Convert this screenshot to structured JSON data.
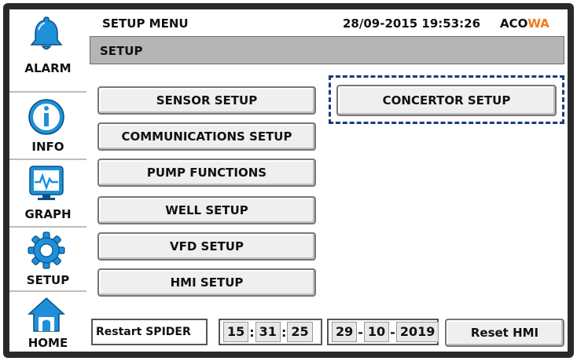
{
  "header": {
    "title": "SETUP MENU",
    "datetime": "28/09-2015  19:53:26",
    "brand_prefix": "ACO",
    "brand_suffix": "WA"
  },
  "section": {
    "title": "SETUP"
  },
  "sidebar": {
    "items": [
      {
        "label": "ALARM",
        "icon": "bell-icon"
      },
      {
        "label": "INFO",
        "icon": "info-icon"
      },
      {
        "label": "GRAPH",
        "icon": "monitor-graph-icon"
      },
      {
        "label": "SETUP",
        "icon": "gear-icon"
      },
      {
        "label": "HOME",
        "icon": "house-icon"
      }
    ]
  },
  "menu": {
    "buttons": [
      "SENSOR SETUP",
      "COMMUNICATIONS SETUP",
      "PUMP FUNCTIONS",
      "WELL SETUP",
      "VFD SETUP",
      "HMI SETUP"
    ],
    "concentrator": "CONCERTOR SETUP"
  },
  "footer": {
    "restart_label": "Restart SPIDER",
    "time": {
      "hour": "15",
      "minute": "31",
      "second": "25"
    },
    "date": {
      "day": "29",
      "month": "10",
      "year": "2019"
    },
    "time_sep": ":",
    "date_sep": "-",
    "reset_label": "Reset HMI"
  },
  "colors": {
    "bezel": "#2a2a2a",
    "section_bar": "#b5b5b5",
    "brand_accent": "#f07a1a",
    "selection_outline": "#1b3a7a",
    "icon_blue": "#1e8fd8"
  }
}
